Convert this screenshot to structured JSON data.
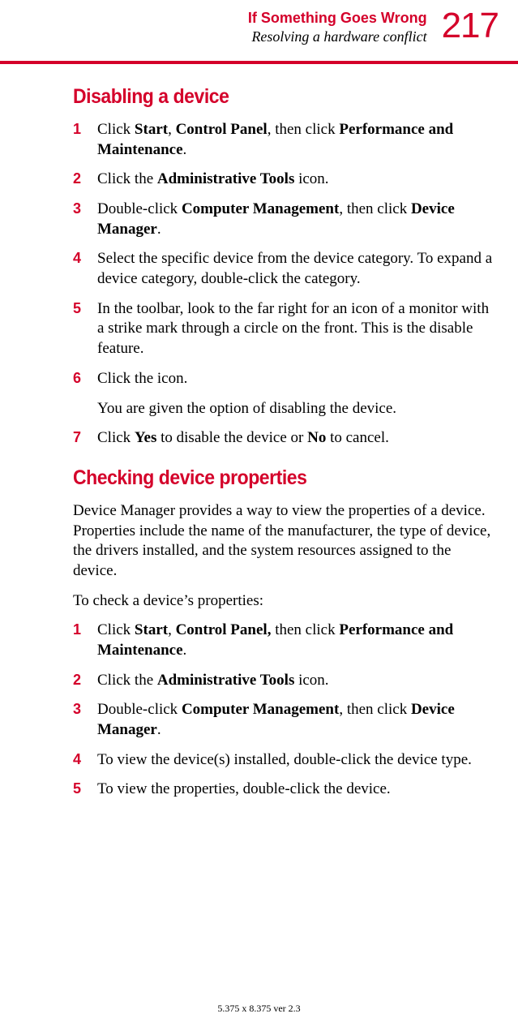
{
  "header": {
    "chapter": "If Something Goes Wrong",
    "section": "Resolving a hardware conflict",
    "page": "217"
  },
  "s1": {
    "heading": "Disabling a device",
    "steps": [
      {
        "n": "1",
        "html": "Click <b>Start</b>, <b>Control Panel</b>, then click <b>Performance and Maintenance</b>."
      },
      {
        "n": "2",
        "html": "Click the <b>Administrative Tools</b> icon."
      },
      {
        "n": "3",
        "html": "Double-click <b>Computer Management</b>, then click <b>Device Manager</b>."
      },
      {
        "n": "4",
        "html": "Select the specific device from the device category. To expand a device category, double-click the category."
      },
      {
        "n": "5",
        "html": "In the toolbar, look to the far right for an icon of a monitor with a strike mark through a circle on the front. This is the disable feature."
      },
      {
        "n": "6",
        "html": "Click the icon."
      }
    ],
    "note6": "You are given the option of disabling the device.",
    "step7": {
      "n": "7",
      "html": "Click <b>Yes</b> to disable the device or <b>No</b> to cancel."
    }
  },
  "s2": {
    "heading": "Checking device properties",
    "intro": "Device Manager provides a way to view the properties of a device. Properties include the name of the manufacturer, the type of device, the drivers installed, and the system resources assigned to the device.",
    "lead": "To check a device’s properties:",
    "steps": [
      {
        "n": "1",
        "html": "Click <b>Start</b>, <b>Control Panel,</b> then click <b>Performance and Maintenance</b>."
      },
      {
        "n": "2",
        "html": "Click the <b>Administrative Tools</b> icon."
      },
      {
        "n": "3",
        "html": "Double-click <b>Computer Management</b>, then click <b>Device Manager</b>."
      },
      {
        "n": "4",
        "html": "To view the device(s) installed, double-click the device type."
      },
      {
        "n": "5",
        "html": "To view the properties, double-click the device."
      }
    ]
  },
  "footer": "5.375 x 8.375 ver 2.3"
}
